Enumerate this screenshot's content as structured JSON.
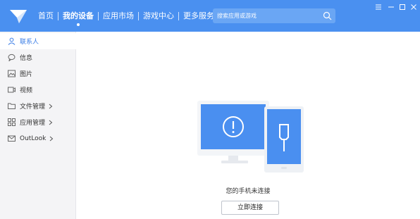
{
  "nav": {
    "items": [
      {
        "label": "首页"
      },
      {
        "label": "我的设备",
        "active": true
      },
      {
        "label": "应用市场"
      },
      {
        "label": "游戏中心"
      },
      {
        "label": "更多服务"
      }
    ]
  },
  "search": {
    "placeholder": "搜索应用或游戏"
  },
  "sidebar": {
    "items": [
      {
        "label": "联系人",
        "icon": "person-icon",
        "active": true
      },
      {
        "label": "信息",
        "icon": "message-icon"
      },
      {
        "label": "图片",
        "icon": "image-icon"
      },
      {
        "label": "视频",
        "icon": "video-icon"
      },
      {
        "label": "文件管理",
        "icon": "folder-icon",
        "expandable": true
      },
      {
        "label": "应用管理",
        "icon": "apps-grid-icon",
        "expandable": true
      },
      {
        "label": "OutLook",
        "icon": "mail-icon",
        "expandable": true
      }
    ]
  },
  "main": {
    "status_text": "您的手机未连接",
    "connect_label": "立即连接"
  },
  "colors": {
    "accent": "#4a90f0",
    "active_text": "#3a7de6"
  }
}
